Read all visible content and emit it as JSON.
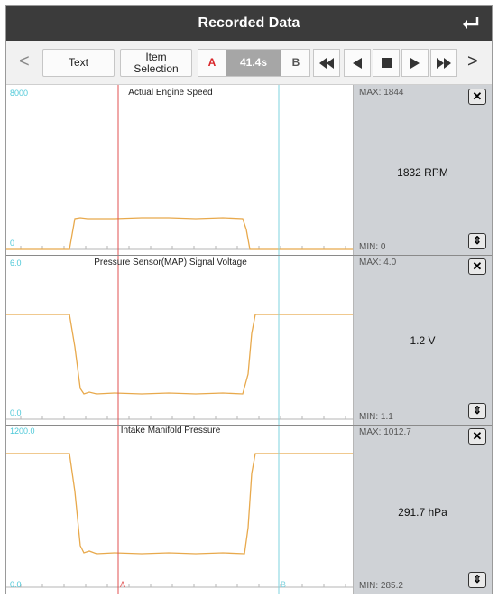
{
  "header": {
    "title": "Recorded Data",
    "back_icon": "return-arrow-icon"
  },
  "toolbar": {
    "prev_label": "<",
    "text_label": "Text",
    "item_selection_label": "Item\nSelection",
    "cursor_a_label": "A",
    "time_label": "41.4s",
    "cursor_b_label": "B",
    "next_label": ">"
  },
  "graphs": [
    {
      "title": "Actual Engine Speed",
      "ymax_label": "8000",
      "ymin_label": "0",
      "max_text": "MAX: 1844",
      "min_text": "MIN: 0",
      "value_text": "1832 RPM"
    },
    {
      "title": "Pressure Sensor(MAP) Signal Voltage",
      "ymax_label": "6.0",
      "ymin_label": "0.0",
      "max_text": "MAX: 4.0",
      "min_text": "MIN: 1.1",
      "value_text": "1.2 V"
    },
    {
      "title": "Intake Manifold Pressure",
      "ymax_label": "1200.0",
      "ymin_label": "0.0",
      "max_text": "MAX: 1012.7",
      "min_text": "MIN: 285.2",
      "value_text": "291.7 hPa"
    }
  ],
  "cursors": {
    "a_label": "A",
    "b_label": "B"
  },
  "colors": {
    "trace": "#e8a94c",
    "cursor_a": "#e05050",
    "cursor_b": "#7fd3df",
    "axis_label": "#4dc8d8",
    "titlebar": "#3b3b3b",
    "panel": "#cfd2d6"
  }
}
